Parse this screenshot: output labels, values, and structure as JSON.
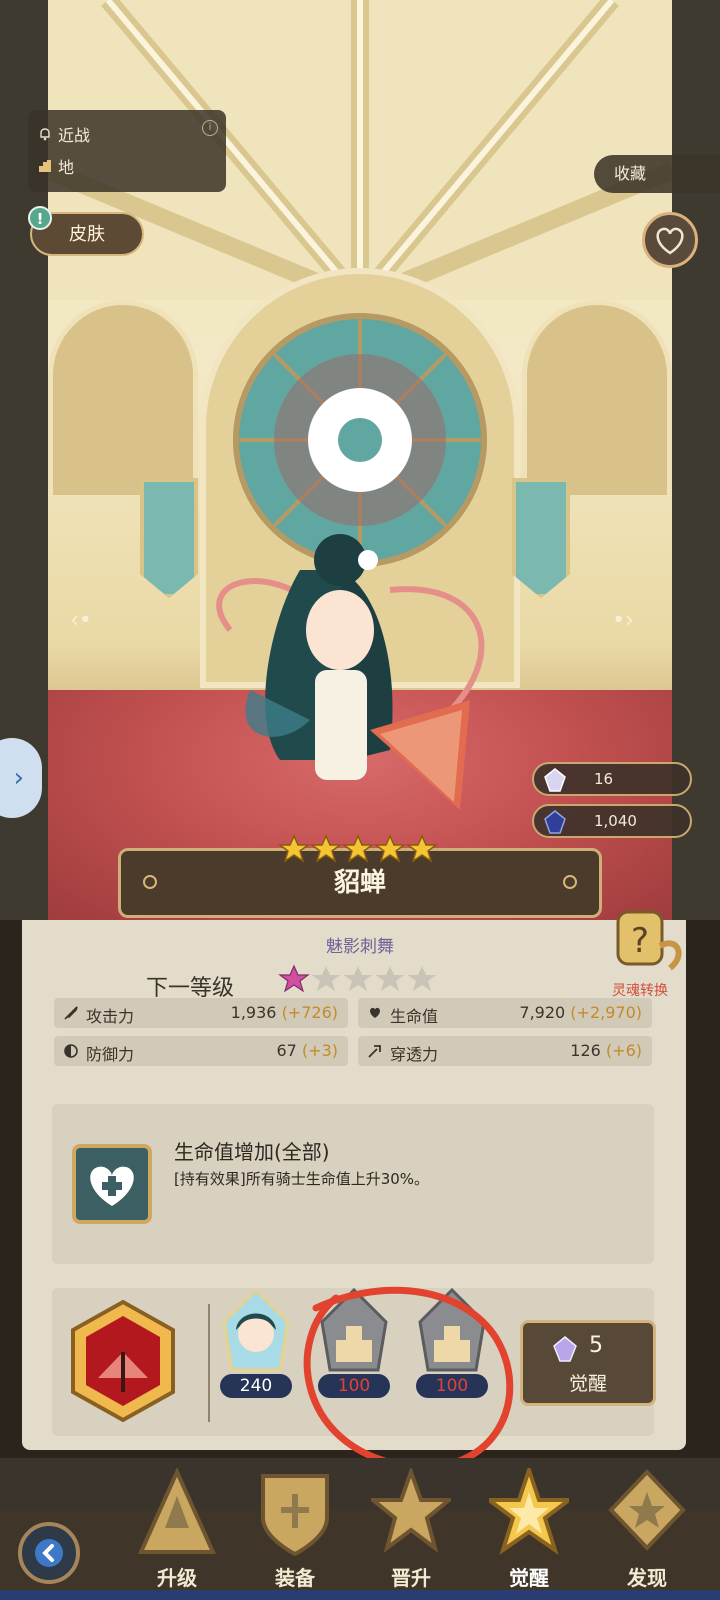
{
  "hero": {
    "attack_type": "近战",
    "element": "地",
    "name": "貂蝉",
    "subtitle": "魅影刺舞",
    "rarity_stars": 5
  },
  "buttons": {
    "skin": "皮肤",
    "favorite": "收藏",
    "awaken_label": "觉醒",
    "awaken_cost": "5"
  },
  "currencies": [
    {
      "name": "crystal",
      "value": "16"
    },
    {
      "name": "sapphire",
      "value": "1,040"
    }
  ],
  "next_level": {
    "label": "下一等级",
    "filled_stars": 1,
    "total_stars": 5
  },
  "spirit_swap": {
    "label": "灵魂转换"
  },
  "stats": [
    {
      "label": "攻击力",
      "value": "1,936",
      "bonus": "(+726)",
      "icon": "sword-icon"
    },
    {
      "label": "生命值",
      "value": "7,920",
      "bonus": "(+2,970)",
      "icon": "heart-icon"
    },
    {
      "label": "防御力",
      "value": "67",
      "bonus": "(+3)",
      "icon": "shield-icon"
    },
    {
      "label": "穿透力",
      "value": "126",
      "bonus": "(+6)",
      "icon": "pierce-icon"
    }
  ],
  "effect": {
    "title": "生命值增加(全部)",
    "description": "[持有效果]所有骑士生命值上升30%。"
  },
  "materials": [
    {
      "kind": "hero-portrait",
      "count": "240"
    },
    {
      "kind": "locked-material",
      "count": "100"
    },
    {
      "kind": "locked-material",
      "count": "100"
    }
  ],
  "nav": [
    {
      "label": "升级",
      "icon": "upgrade-icon"
    },
    {
      "label": "装备",
      "icon": "equipment-icon"
    },
    {
      "label": "晋升",
      "icon": "promote-icon"
    },
    {
      "label": "觉醒",
      "icon": "awaken-icon"
    },
    {
      "label": "发现",
      "icon": "discover-icon"
    }
  ],
  "colors": {
    "bonus": "#c48a2a",
    "count_normal": "#ffffff",
    "count_short": "#e0423a",
    "annotation": "#e2432f",
    "subtitle": "#6f6298"
  }
}
